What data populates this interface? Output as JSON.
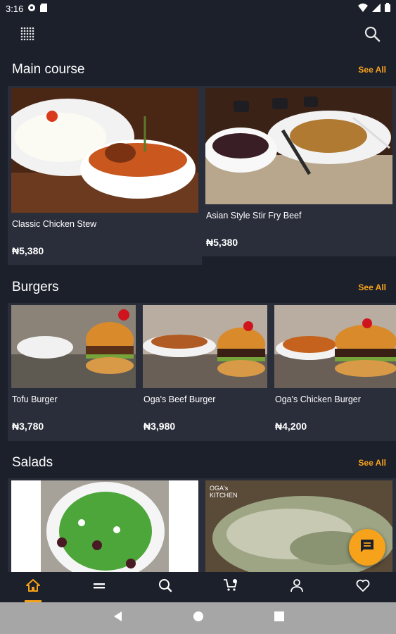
{
  "status": {
    "time": "3:16"
  },
  "sections": [
    {
      "title": "Main course",
      "see_all": "See All",
      "items": [
        {
          "name": "Classic Chicken Stew",
          "price": "₦5,380"
        },
        {
          "name": "Asian Style Stir Fry Beef",
          "price": "₦5,380"
        }
      ]
    },
    {
      "title": "Burgers",
      "see_all": "See All",
      "items": [
        {
          "name": "Tofu Burger",
          "price": "₦3,780"
        },
        {
          "name": "Oga's Beef Burger",
          "price": "₦3,980"
        },
        {
          "name": "Oga's Chicken Burger",
          "price": "₦4,200"
        }
      ]
    },
    {
      "title": "Salads",
      "see_all": "See All",
      "items": [
        {
          "name": "",
          "price": ""
        },
        {
          "name": "",
          "price": ""
        }
      ]
    }
  ],
  "watermark": {
    "brand_line1": "OGA's",
    "brand_line2": "KITCHEN"
  },
  "colors": {
    "accent": "#f7a21b",
    "background": "#1c202b",
    "card": "#2a2e3b"
  },
  "icons": {
    "menu": "grid-dots-icon",
    "search": "search-icon",
    "nav": [
      "home-icon",
      "menu-lines-icon",
      "search-icon",
      "cart-icon",
      "user-icon",
      "heart-icon"
    ],
    "fab": "chat-icon"
  }
}
